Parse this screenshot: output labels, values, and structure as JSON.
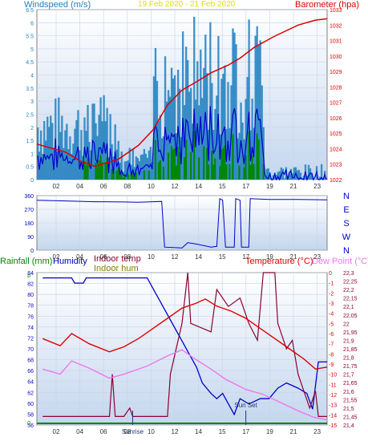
{
  "colors": {
    "wind_avg": "#0000cc",
    "wind_gust": "#1e7fbe",
    "wind_low": "#008800",
    "barometer": "#dd0000",
    "direction": "#0000cc",
    "humidity": "#0000cc",
    "indoor_temp": "#8b0033",
    "indoor_hum": "#808000",
    "temperature": "#dd0000",
    "dew_point": "#ee77ee",
    "rainfall": "#008800",
    "panel_bg": "#dfe8f6"
  },
  "top_chart": {
    "title_left": "Windspeed (m/s)",
    "title_center": "19 Feb 2020 - 21 Feb 2020",
    "title_right": "Barometer (hpa)",
    "y_left_ticks": [
      "0",
      "0.5",
      "1",
      "1.5",
      "2",
      "2.5",
      "3",
      "3.5",
      "4",
      "4.5",
      "5",
      "5.5",
      "6",
      "6.5"
    ],
    "y_right_ticks": [
      "1022",
      "1023",
      "1024",
      "1025",
      "1026",
      "1027",
      "1028",
      "1029",
      "1030",
      "1031",
      "1032",
      "1033"
    ],
    "x_ticks": [
      "02",
      "04",
      "06",
      "08",
      "10",
      "12",
      "14",
      "15",
      "17",
      "19",
      "21",
      "23"
    ]
  },
  "dir_chart": {
    "y_left_ticks": [
      "0",
      "90",
      "180",
      "270",
      "360"
    ],
    "y_right_labels": [
      "N",
      "W",
      "S",
      "E",
      "N"
    ],
    "x_ticks": [
      "02",
      "04",
      "06",
      "08",
      "10",
      "12",
      "14",
      "15",
      "17",
      "19",
      "21",
      "23"
    ]
  },
  "bottom_chart": {
    "label_rainfall": "Rainfall (mm)",
    "label_humidity": "Humidity",
    "label_indoor_temp": "Indoor temp",
    "label_indoor_hum": "Indoor hum",
    "label_temperature": "Temperature (°C)",
    "label_dew_point": "Dew Point (°C)",
    "y_left_ticks": [
      "56",
      "58",
      "60",
      "62",
      "64",
      "66",
      "68",
      "70",
      "72",
      "74",
      "76",
      "78",
      "80",
      "82",
      "84"
    ],
    "y_left_top": "b",
    "y_left_bottom": "0",
    "y_right1_ticks": [
      "-15",
      "-14",
      "-13",
      "-12",
      "-11",
      "-10",
      "-9",
      "-8",
      "-7",
      "-6",
      "-5",
      "-4",
      "-3",
      "-2",
      "-1",
      "0"
    ],
    "y_right2_ticks": [
      "21,4",
      "21,45",
      "21,5",
      "21,55",
      "21,6",
      "21,65",
      "21,7",
      "21,75",
      "21,8",
      "21,85",
      "21,9",
      "21,95",
      "22",
      "22,05",
      "22,1",
      "22,15",
      "22,2",
      "22,25",
      "22,3"
    ],
    "x_ticks": [
      "02",
      "04",
      "06",
      "08",
      "10",
      "12",
      "14",
      "15",
      "17",
      "19",
      "21",
      "23"
    ],
    "sunrise": "Sunrise",
    "sunset": "Sun Set"
  }
}
